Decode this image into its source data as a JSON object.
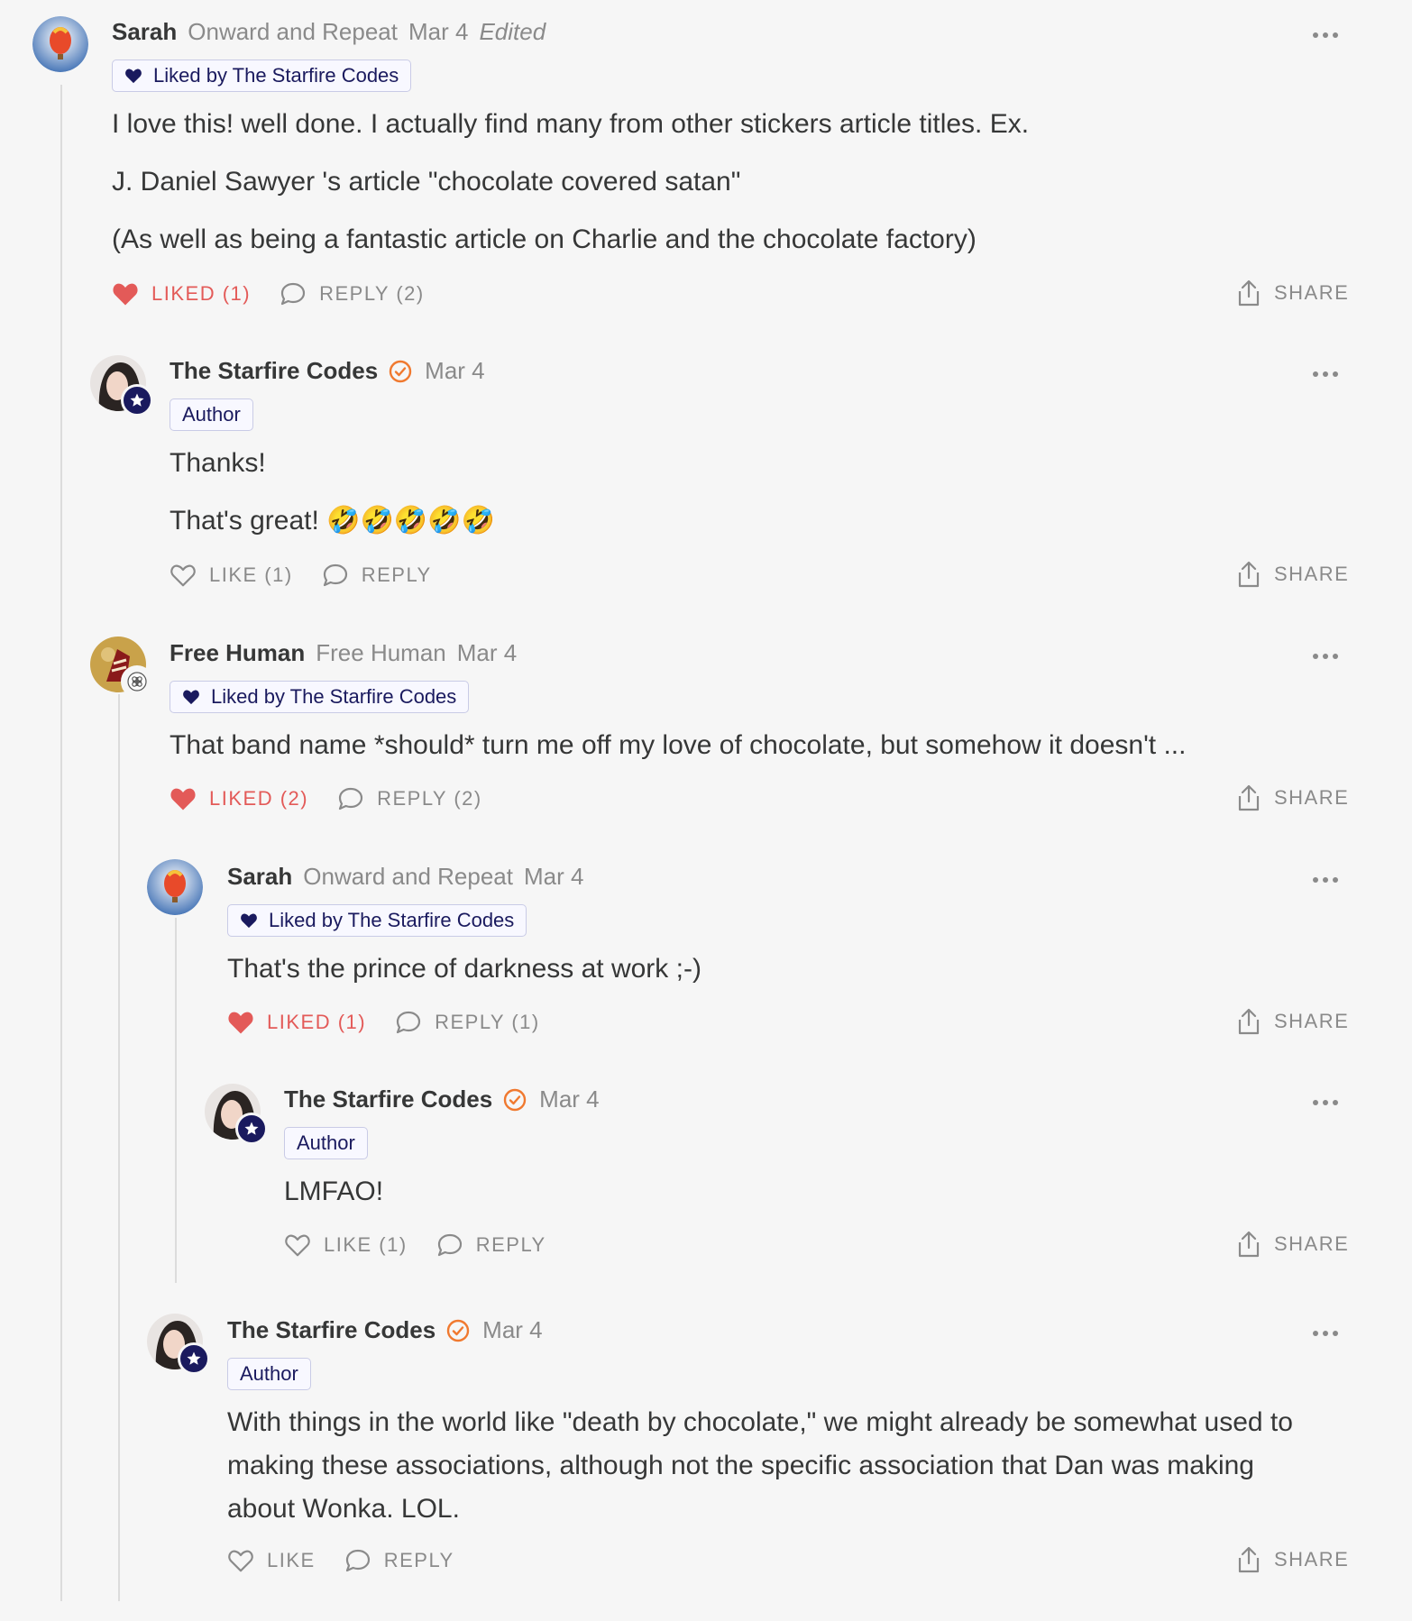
{
  "c1": {
    "name": "Sarah",
    "publication": "Onward and Repeat",
    "date": "Mar 4",
    "edited": "Edited",
    "liked_by": "Liked by The Starfire Codes",
    "paragraphs": [
      "I love this! well done. I actually find many from other stickers article titles. Ex.",
      "J. Daniel Sawyer 's article \"chocolate covered satan\"",
      "(As well as being a fantastic article on Charlie and the chocolate factory)"
    ],
    "like_label": "LIKED (1)",
    "reply_label": "REPLY (2)",
    "share_label": "SHARE"
  },
  "c2": {
    "name": "The Starfire Codes",
    "date": "Mar 4",
    "badge": "Author",
    "paragraphs": [
      "Thanks!",
      "That's great! 🤣🤣🤣🤣🤣"
    ],
    "like_label": "LIKE (1)",
    "reply_label": "REPLY",
    "share_label": "SHARE"
  },
  "c3": {
    "name": "Free Human",
    "publication": "Free Human",
    "date": "Mar 4",
    "liked_by": "Liked by The Starfire Codes",
    "paragraphs": [
      "That band name *should* turn me off my love of chocolate, but somehow it doesn't ..."
    ],
    "like_label": "LIKED (2)",
    "reply_label": "REPLY (2)",
    "share_label": "SHARE"
  },
  "c4": {
    "name": "Sarah",
    "publication": "Onward and Repeat",
    "date": "Mar 4",
    "liked_by": "Liked by The Starfire Codes",
    "paragraphs": [
      "That's the prince of darkness at work ;-)"
    ],
    "like_label": "LIKED (1)",
    "reply_label": "REPLY (1)",
    "share_label": "SHARE"
  },
  "c5": {
    "name": "The Starfire Codes",
    "date": "Mar 4",
    "badge": "Author",
    "paragraphs": [
      "LMFAO!"
    ],
    "like_label": "LIKE (1)",
    "reply_label": "REPLY",
    "share_label": "SHARE"
  },
  "c6": {
    "name": "The Starfire Codes",
    "date": "Mar 4",
    "badge": "Author",
    "paragraphs": [
      "With things in the world like \"death by chocolate,\" we might already be somewhat used to",
      "making these associations, although not the specific association that Dan was making",
      "about Wonka. LOL."
    ],
    "like_label": "LIKE",
    "reply_label": "REPLY",
    "share_label": "SHARE"
  },
  "colors": {
    "liked": "#e35a58",
    "accent_navy": "#1a1a5e",
    "check_orange": "#f0792f",
    "muted": "#8a8a8a"
  }
}
